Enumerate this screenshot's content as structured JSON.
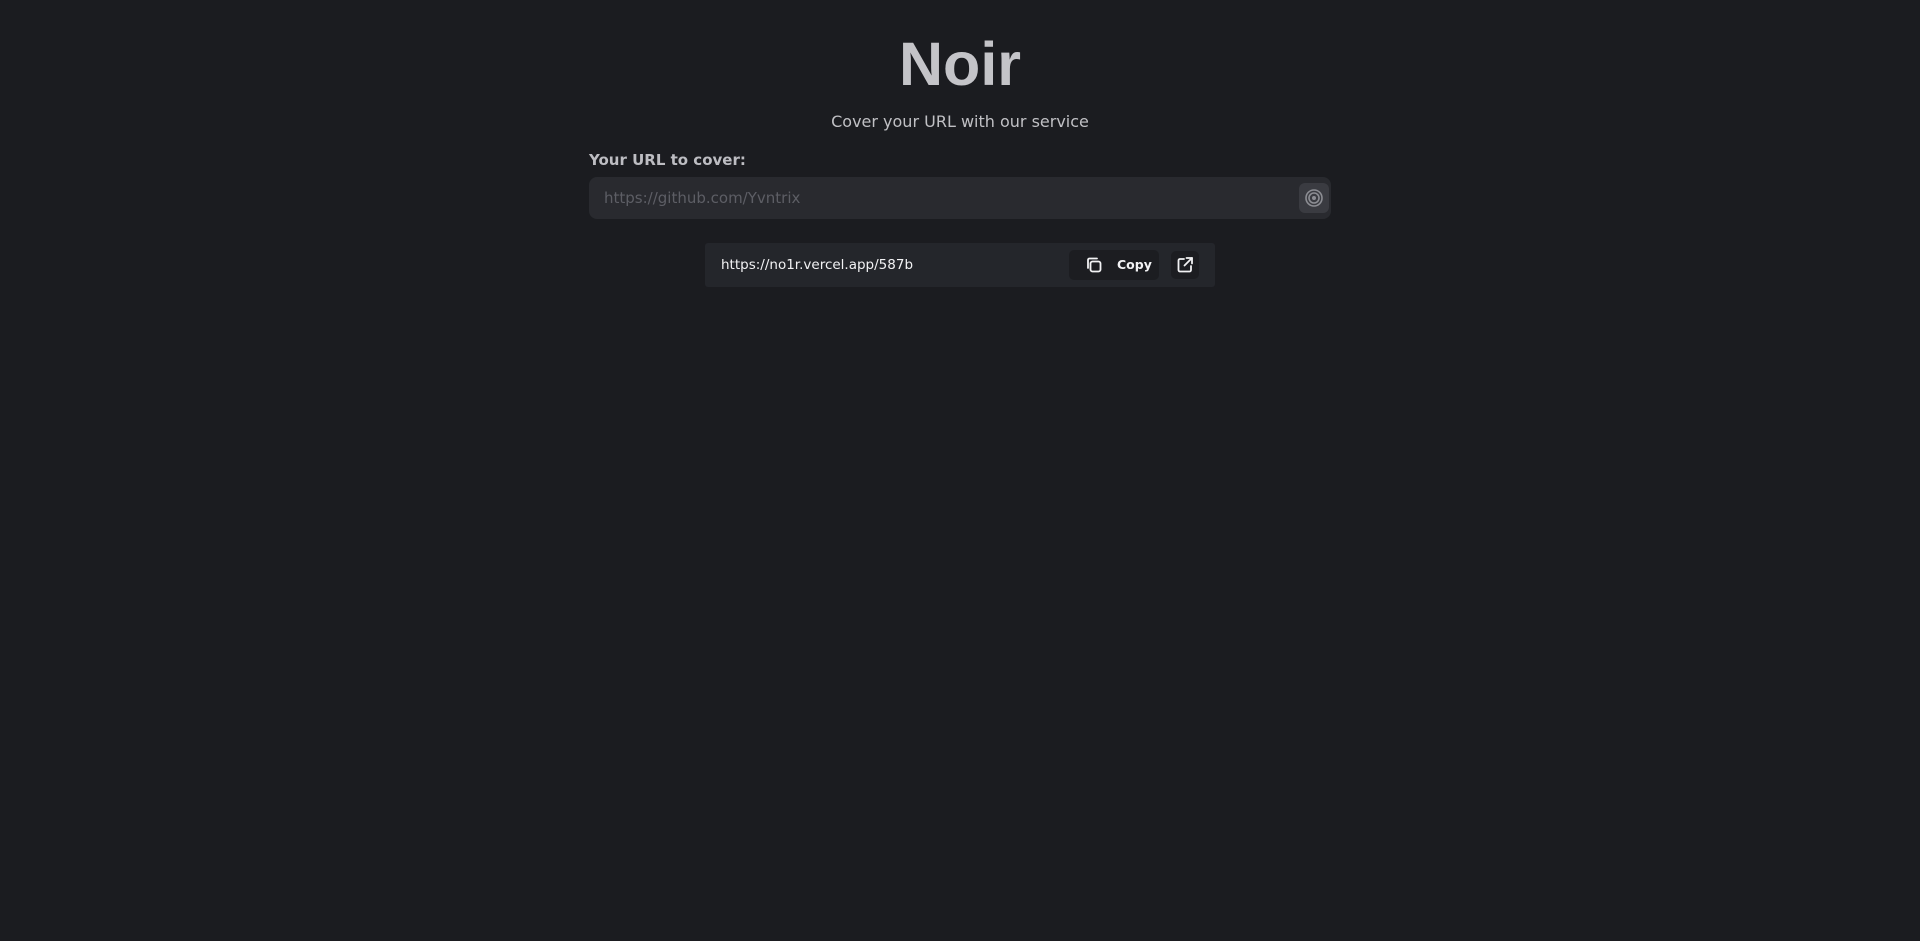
{
  "app": {
    "title": "Noir",
    "tagline": "Cover your URL with our service"
  },
  "form": {
    "label": "Your URL to cover:",
    "input_value": "",
    "input_placeholder": "https://github.com/Yvntrix",
    "submit_icon": "target-icon"
  },
  "result": {
    "short_url": "https://no1r.vercel.app/587b",
    "copy_label": "Copy",
    "copy_icon": "copy-icon",
    "open_icon": "external-link-icon"
  },
  "colors": {
    "background": "#1b1c20",
    "input_background": "#292a2f",
    "card_background": "#24262b",
    "button_background": "#1c1d21",
    "title_text": "#c4c4c8",
    "placeholder_text": "#5d5e65"
  }
}
